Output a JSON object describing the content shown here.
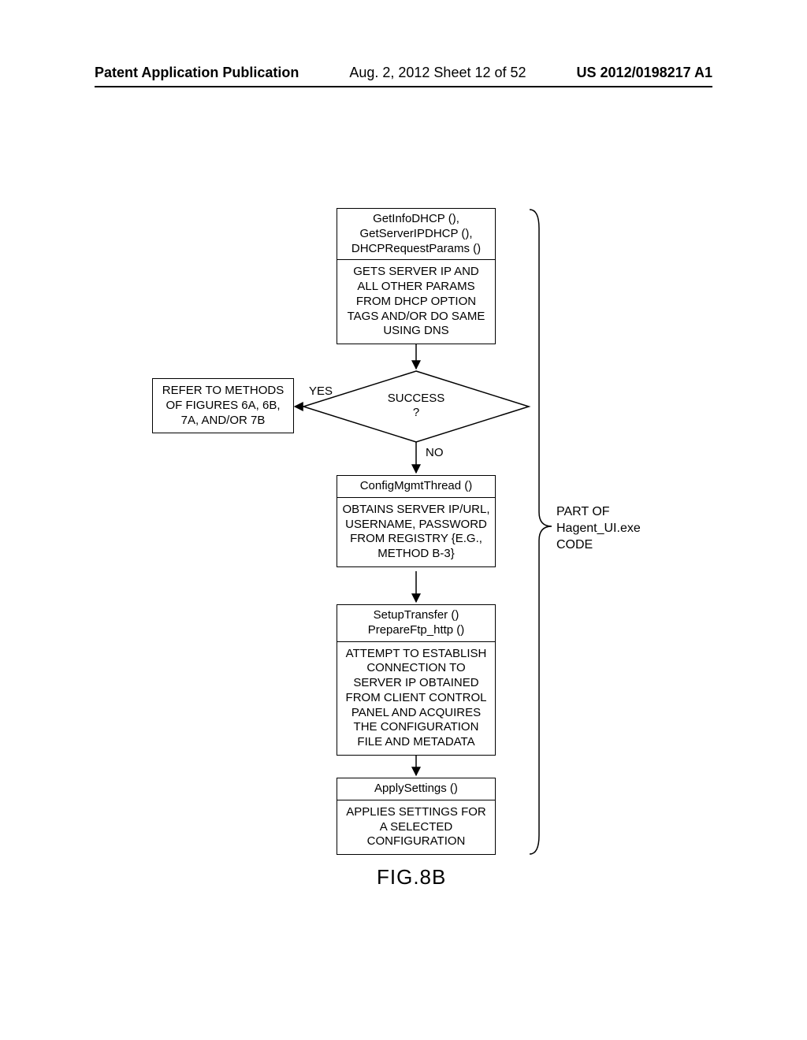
{
  "header": {
    "left": "Patent Application Publication",
    "middle": "Aug. 2, 2012  Sheet 12 of 52",
    "right": "US 2012/0198217 A1"
  },
  "box_refer": "REFER TO METHODS OF FIGURES 6A, 6B, 7A, AND/OR 7B",
  "box_dhcp": {
    "title": "GetInfoDHCP (),\nGetServerIPDHCP (),\nDHCPRequestParams ()",
    "body": "GETS SERVER IP AND ALL OTHER PARAMS FROM DHCP OPTION TAGS AND/OR DO SAME USING DNS"
  },
  "decision": "SUCCESS\n?",
  "edge_yes": "YES",
  "edge_no": "NO",
  "box_cfg": {
    "title": "ConfigMgmtThread ()",
    "body": "OBTAINS SERVER IP/URL, USERNAME, PASSWORD FROM REGISTRY {E.G., METHOD B-3}"
  },
  "box_setup": {
    "title": "SetupTransfer ()\nPrepareFtp_http ()",
    "body": "ATTEMPT TO ESTABLISH CONNECTION TO SERVER IP OBTAINED FROM CLIENT CONTROL PANEL AND ACQUIRES THE CONFIGURATION FILE AND METADATA"
  },
  "box_apply": {
    "title": "ApplySettings ()",
    "body": "APPLIES SETTINGS FOR A SELECTED CONFIGURATION"
  },
  "brace_label": "PART OF\nHagent_UI.exe\nCODE",
  "figure_label": "FIG.8B"
}
